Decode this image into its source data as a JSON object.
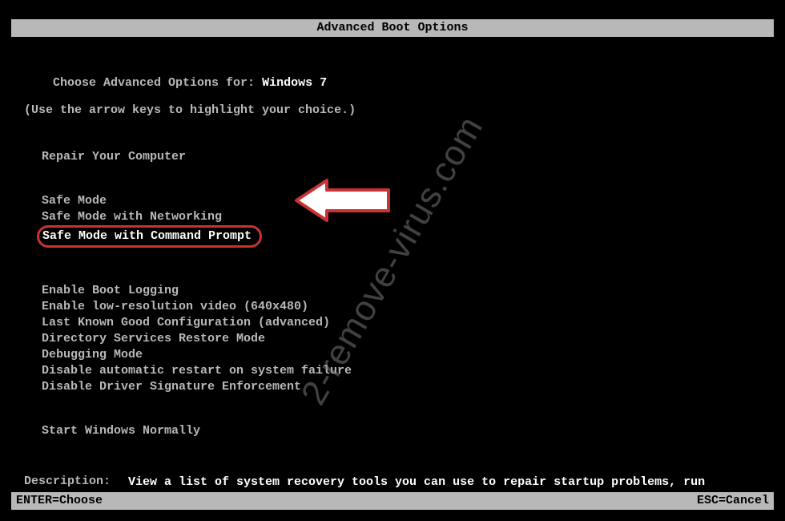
{
  "title": "Advanced Boot Options",
  "heading_prefix": "Choose Advanced Options for: ",
  "os_name": "Windows 7",
  "subheading": "(Use the arrow keys to highlight your choice.)",
  "group1": {
    "item0": "Repair Your Computer"
  },
  "group2": {
    "item0": "Safe Mode",
    "item1": "Safe Mode with Networking",
    "item2": "Safe Mode with Command Prompt"
  },
  "group3": {
    "item0": "Enable Boot Logging",
    "item1": "Enable low-resolution video (640x480)",
    "item2": "Last Known Good Configuration (advanced)",
    "item3": "Directory Services Restore Mode",
    "item4": "Debugging Mode",
    "item5": "Disable automatic restart on system failure",
    "item6": "Disable Driver Signature Enforcement"
  },
  "group4": {
    "item0": "Start Windows Normally"
  },
  "description": {
    "label": "Description:",
    "text": "View a list of system recovery tools you can use to repair startup problems, run diagnostics, or restore your system."
  },
  "footer": {
    "left": "ENTER=Choose",
    "right": "ESC=Cancel"
  },
  "watermark": "2-remove-virus.com"
}
